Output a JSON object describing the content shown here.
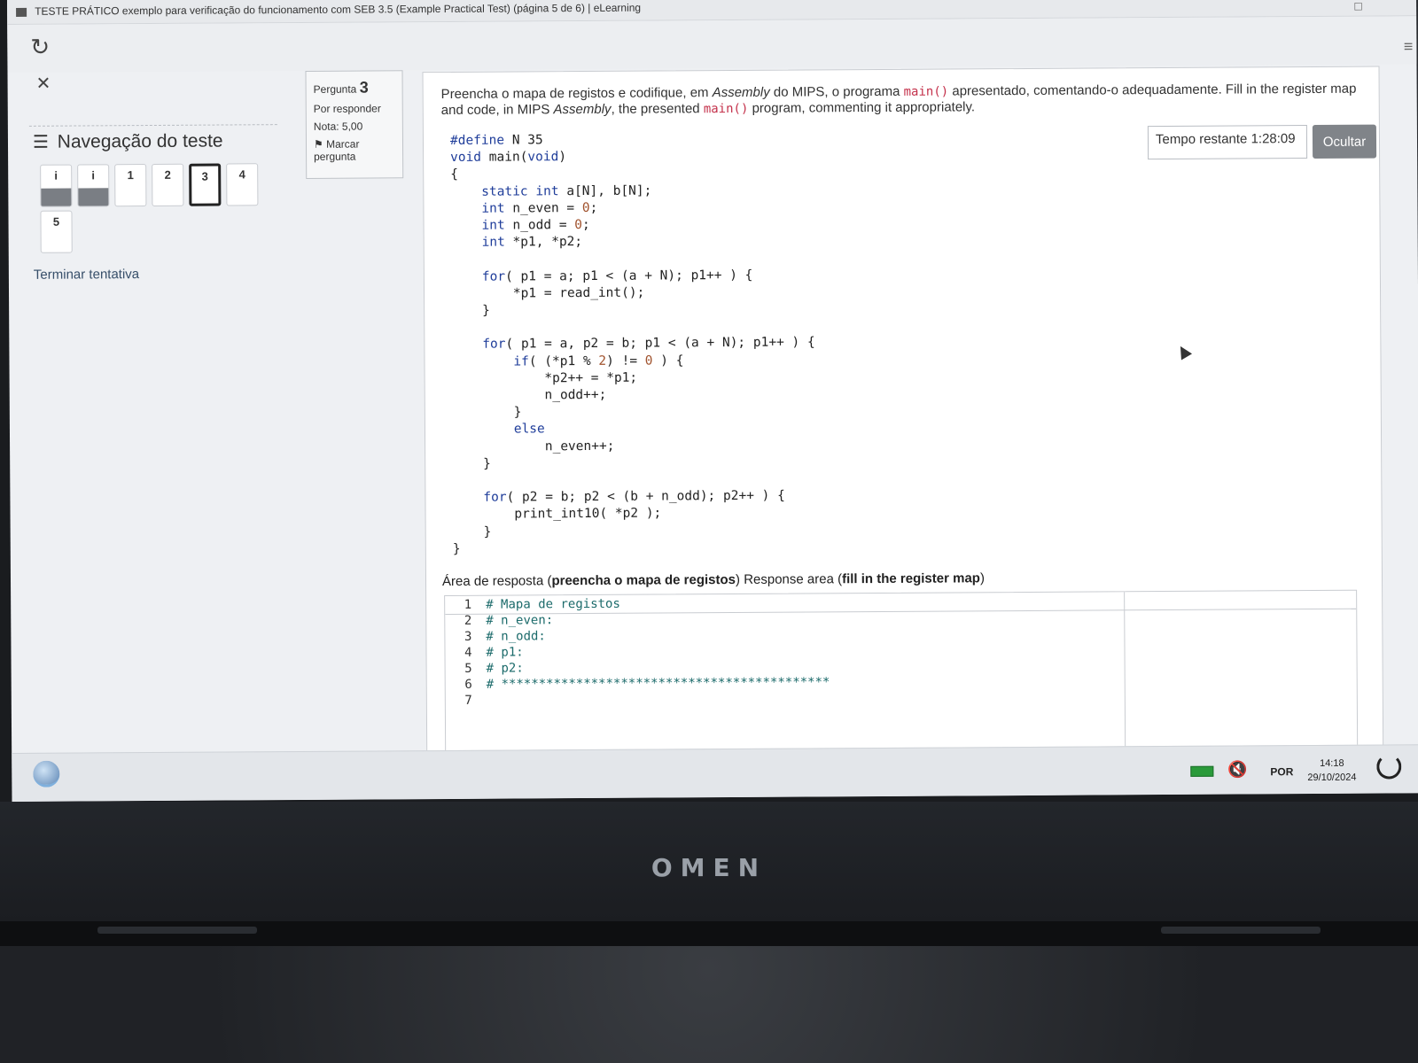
{
  "window": {
    "title": "TESTE PRÁTICO exemplo para verificação do funcionamento com SEB 3.5 (Example Practical Test) (página 5 de 6) | eLearning"
  },
  "nav": {
    "title": "Navegação do teste",
    "buttons": [
      {
        "label": "i",
        "state": "answered"
      },
      {
        "label": "i",
        "state": "answered"
      },
      {
        "label": "1",
        "state": "unanswered"
      },
      {
        "label": "2",
        "state": "unanswered"
      },
      {
        "label": "3",
        "state": "current"
      },
      {
        "label": "4",
        "state": "unanswered"
      },
      {
        "label": "5",
        "state": "unanswered"
      }
    ],
    "finish": "Terminar tentativa"
  },
  "question_info": {
    "label": "Pergunta",
    "number": "3",
    "status": "Por responder",
    "grade": "Nota: 5,00",
    "flag_label": "Marcar pergunta"
  },
  "question": {
    "text_part1": "Preencha o mapa de registos e codifique, em ",
    "text_assembly1": "Assembly",
    "text_part2": " do MIPS, o programa ",
    "text_main": "main()",
    "text_part3": " apresentado, comentando-o adequadamente. Fill in the register map and code, in MIPS ",
    "text_assembly2": "Assembly",
    "text_part4": ", the presented ",
    "text_part5": " program, commenting it appropriately.",
    "code_lines": [
      "#define N 35",
      "void main(void)",
      "{",
      "    static int a[N], b[N];",
      "    int n_even = 0;",
      "    int n_odd = 0;",
      "    int *p1, *p2;",
      "",
      "    for( p1 = a; p1 < (a + N); p1++ ) {",
      "        *p1 = read_int();",
      "    }",
      "",
      "    for( p1 = a, p2 = b; p1 < (a + N); p1++ ) {",
      "        if( (*p1 % 2) != 0 ) {",
      "            *p2++ = *p1;",
      "            n_odd++;",
      "        }",
      "        else",
      "            n_even++;",
      "    }",
      "",
      "    for( p2 = b; p2 < (b + n_odd); p2++ ) {",
      "        print_int10( *p2 );",
      "    }",
      "}"
    ]
  },
  "timer": {
    "label": "Tempo restante 1:28:09",
    "hide_label": "Ocultar"
  },
  "answer": {
    "label_part1": "Área de resposta (",
    "label_bold1": "preencha o mapa de registos",
    "label_part2": ") Response area (",
    "label_bold2": "fill in the register map",
    "label_part3": ")",
    "lines": [
      {
        "n": "1",
        "text": "# Mapa de registos"
      },
      {
        "n": "2",
        "text": "# n_even:"
      },
      {
        "n": "3",
        "text": "# n_odd:"
      },
      {
        "n": "4",
        "text": "# p1:"
      },
      {
        "n": "5",
        "text": "# p2:"
      },
      {
        "n": "6",
        "text": "# ********************************************"
      },
      {
        "n": "7",
        "text": ""
      }
    ]
  },
  "taskbar": {
    "language": "POR",
    "time": "14:18",
    "date": "29/10/2024"
  },
  "hardware": {
    "brand": "OMEN"
  }
}
